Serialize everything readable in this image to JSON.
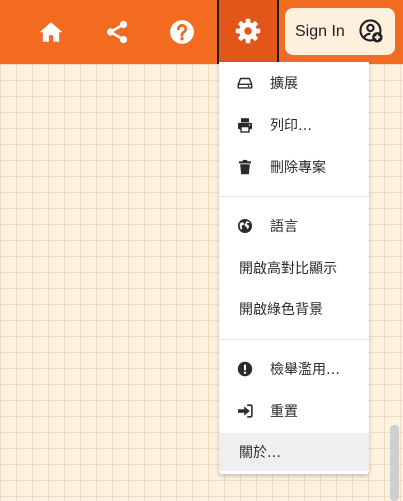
{
  "toolbar": {
    "icons": [
      "home-icon",
      "share-icon",
      "help-icon",
      "gear-icon"
    ],
    "sign_in_label": "Sign In",
    "sign_in_icon": "account-add-icon",
    "background_color": "#f26b21",
    "settings_active_color": "#e2561a"
  },
  "settings_menu": {
    "items": [
      {
        "label": "擴展",
        "icon": "extension-drive-icon"
      },
      {
        "label": "列印…",
        "icon": "print-icon"
      },
      {
        "label": "刪除專案",
        "icon": "trash-icon"
      },
      {
        "label": "語言",
        "icon": "globe-icon"
      },
      {
        "label": "開啟高對比顯示",
        "icon": ""
      },
      {
        "label": "開啟綠色背景",
        "icon": ""
      },
      {
        "label": "檢舉濫用…",
        "icon": "alert-icon"
      },
      {
        "label": "重置",
        "icon": "sign-out-icon"
      },
      {
        "label": "關於…",
        "icon": ""
      }
    ]
  },
  "background_color": "#fdf1df"
}
